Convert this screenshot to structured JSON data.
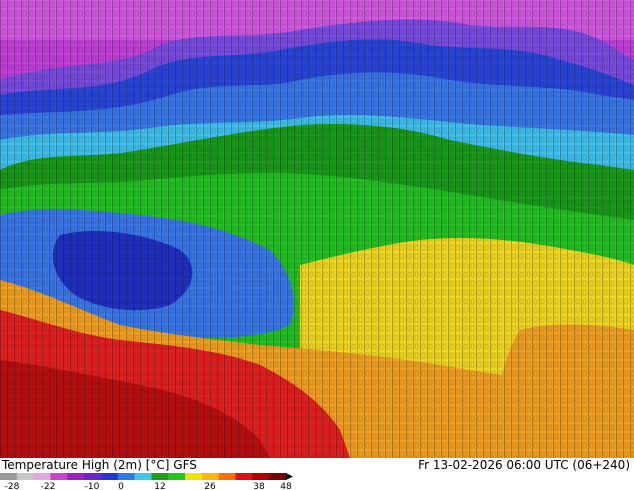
{
  "title": "Temperature High (2m) [°C] GFS",
  "run_info": "Fr 13-02-2026 06:00 UTC (06+240)",
  "legend": {
    "ticks": [
      "-28",
      "-22",
      "-10",
      "0",
      "12",
      "26",
      "38",
      "48"
    ],
    "colors": [
      "#9a9a9a",
      "#c8c8c8",
      "#e0a8e0",
      "#d040d0",
      "#a020c0",
      "#6a28c8",
      "#2836d0",
      "#2a7ae8",
      "#3cc8e8",
      "#1ea01e",
      "#20c820",
      "#f0e400",
      "#ffb400",
      "#ff6e00",
      "#e01010",
      "#b00000",
      "#7a0000"
    ]
  },
  "map_colors": {
    "magenta": "#c040d8",
    "light_magenta": "#e070e8",
    "purple": "#7a4ce0",
    "blue": "#2a46d8",
    "dark_blue": "#2030c0",
    "mid_blue": "#3a78e8",
    "cyan": "#40c0ec",
    "green": "#1a9a1a",
    "bright_green": "#24c024",
    "yellow": "#f0d820",
    "orange": "#f0a020",
    "red": "#e02020",
    "dark_red": "#b81010"
  }
}
